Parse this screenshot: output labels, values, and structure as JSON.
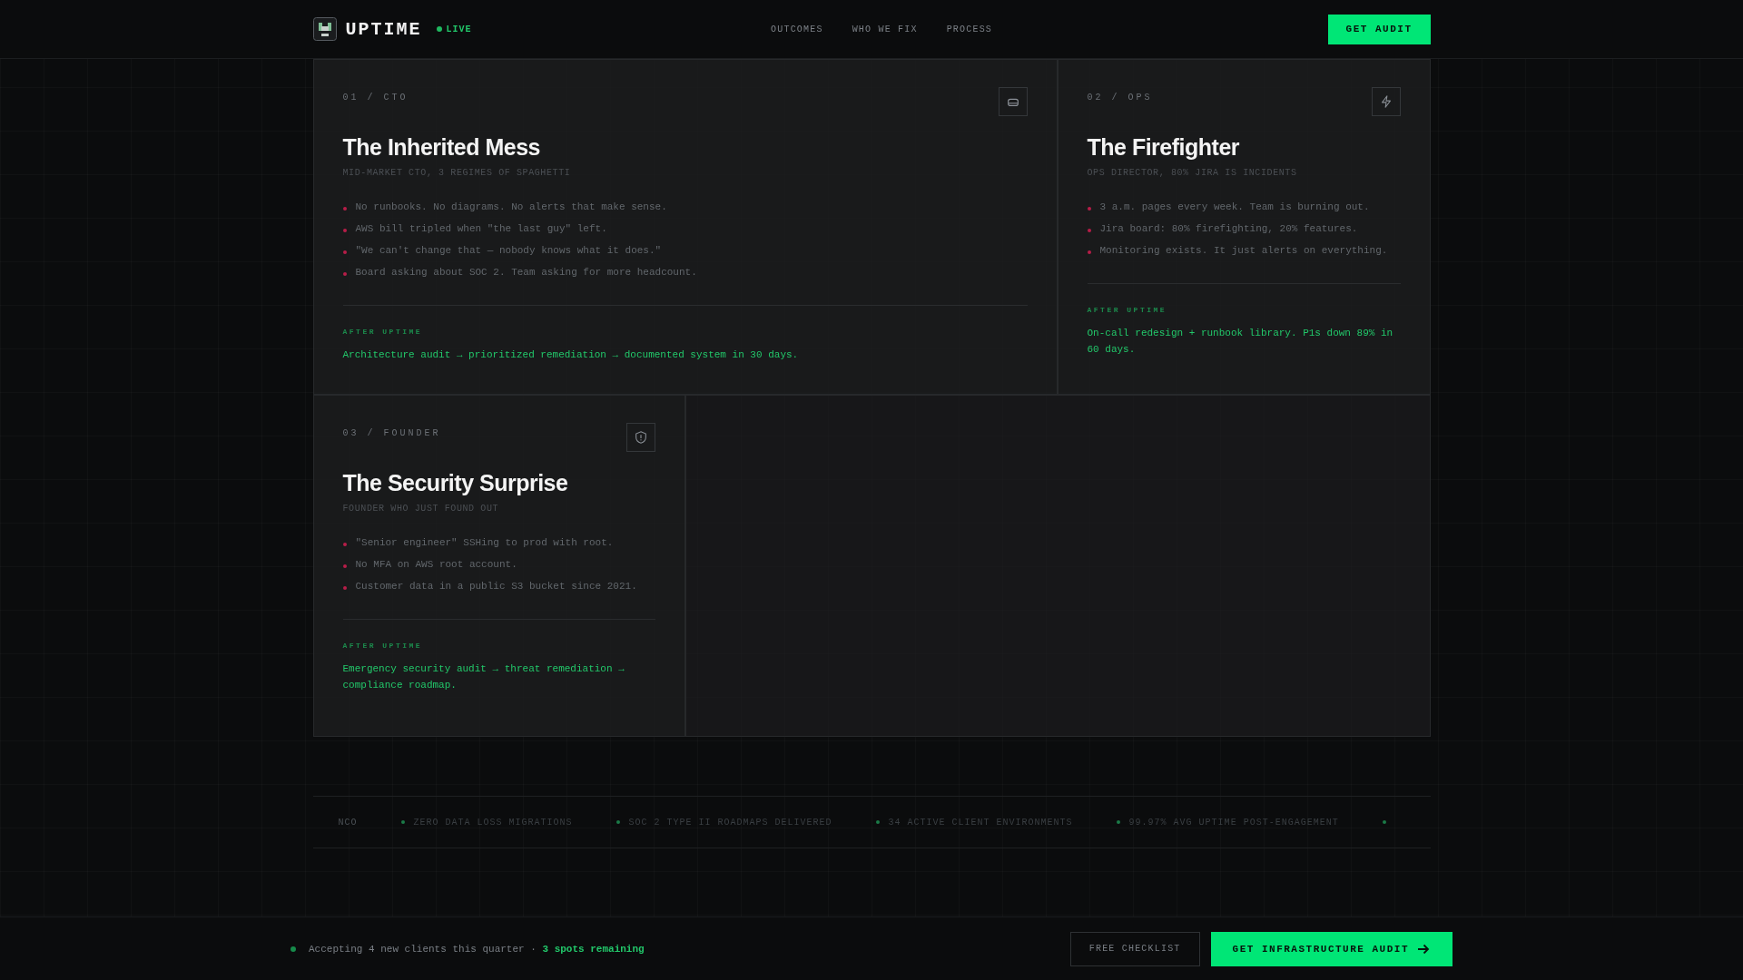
{
  "header": {
    "brand": "UPTIME",
    "status": "LIVE",
    "nav": [
      {
        "label": "OUTCOMES"
      },
      {
        "label": "WHO WE FIX"
      },
      {
        "label": "PROCESS"
      }
    ],
    "cta": "GET AUDIT"
  },
  "cards": [
    {
      "tag": "01 / CTO",
      "title": "The Inherited Mess",
      "subtitle": "MID-MARKET CTO, 3 REGIMES OF SPAGHETTI",
      "bullets": [
        "No runbooks. No diagrams. No alerts that make sense.",
        "AWS bill tripled when \"the last guy\" left.",
        "\"We can't change that — nobody knows what it does.\"",
        "Board asking about SOC 2. Team asking for more headcount."
      ],
      "after_label": "AFTER UPTIME",
      "after_text": "Architecture audit → prioritized remediation → documented system in 30 days."
    },
    {
      "tag": "02 / OPS",
      "title": "The Firefighter",
      "subtitle": "OPS DIRECTOR, 80% JIRA IS INCIDENTS",
      "bullets": [
        "3 a.m. pages every week. Team is burning out.",
        "Jira board: 80% firefighting, 20% features.",
        "Monitoring exists. It just alerts on everything."
      ],
      "after_label": "AFTER UPTIME",
      "after_text": "On-call redesign + runbook library. P1s down 89% in 60 days."
    },
    {
      "tag": "03 / FOUNDER",
      "title": "The Security Surprise",
      "subtitle": "FOUNDER WHO JUST FOUND OUT",
      "bullets": [
        "\"Senior engineer\" SSHing to prod with root.",
        "No MFA on AWS root account.",
        "Customer data in a public S3 bucket since 2021."
      ],
      "after_label": "AFTER UPTIME",
      "after_text": "Emergency security audit → threat remediation → compliance roadmap."
    }
  ],
  "ticker": [
    {
      "text": "NCO",
      "kind": "partial"
    },
    {
      "text": "ZERO DATA LOSS MIGRATIONS",
      "kind": "item"
    },
    {
      "text": "SOC 2 TYPE II ROADMAPS DELIVERED",
      "kind": "item"
    },
    {
      "text": "34 ACTIVE CLIENT ENVIRONMENTS",
      "kind": "item"
    },
    {
      "text": "99.97% AVG UPTIME POST-ENGAGEMENT",
      "kind": "item"
    }
  ],
  "bottom_bar": {
    "message": "Accepting 4 new clients this quarter · **3 spots remaining**",
    "secondary": "FREE CHECKLIST",
    "primary": "GET INFRASTRUCTURE AUDIT"
  }
}
